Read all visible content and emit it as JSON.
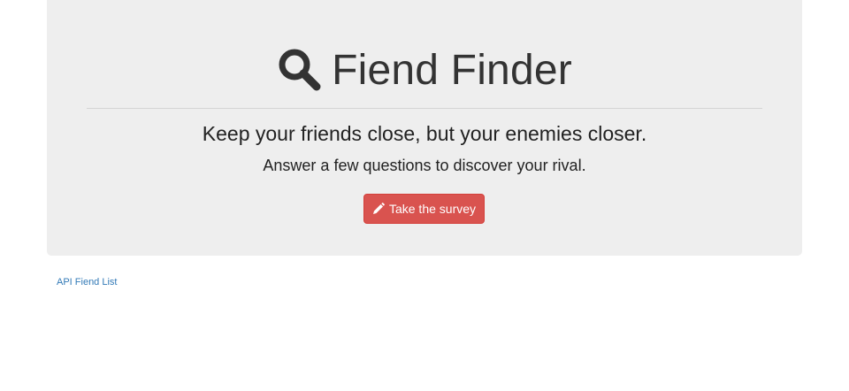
{
  "header": {
    "title": "Fiend Finder",
    "icon": "search-icon"
  },
  "main": {
    "tagline": "Keep your friends close, but your enemies closer.",
    "subline": "Answer a few questions to discover your rival.",
    "survey_button": {
      "label": "Take the survey",
      "icon": "pencil-icon",
      "color": "#d9534f"
    }
  },
  "footer": {
    "api_link": "API Fiend List",
    "link_color": "#337ab7"
  },
  "colors": {
    "jumbotron_bg": "#eeeeee",
    "text": "#333333"
  }
}
